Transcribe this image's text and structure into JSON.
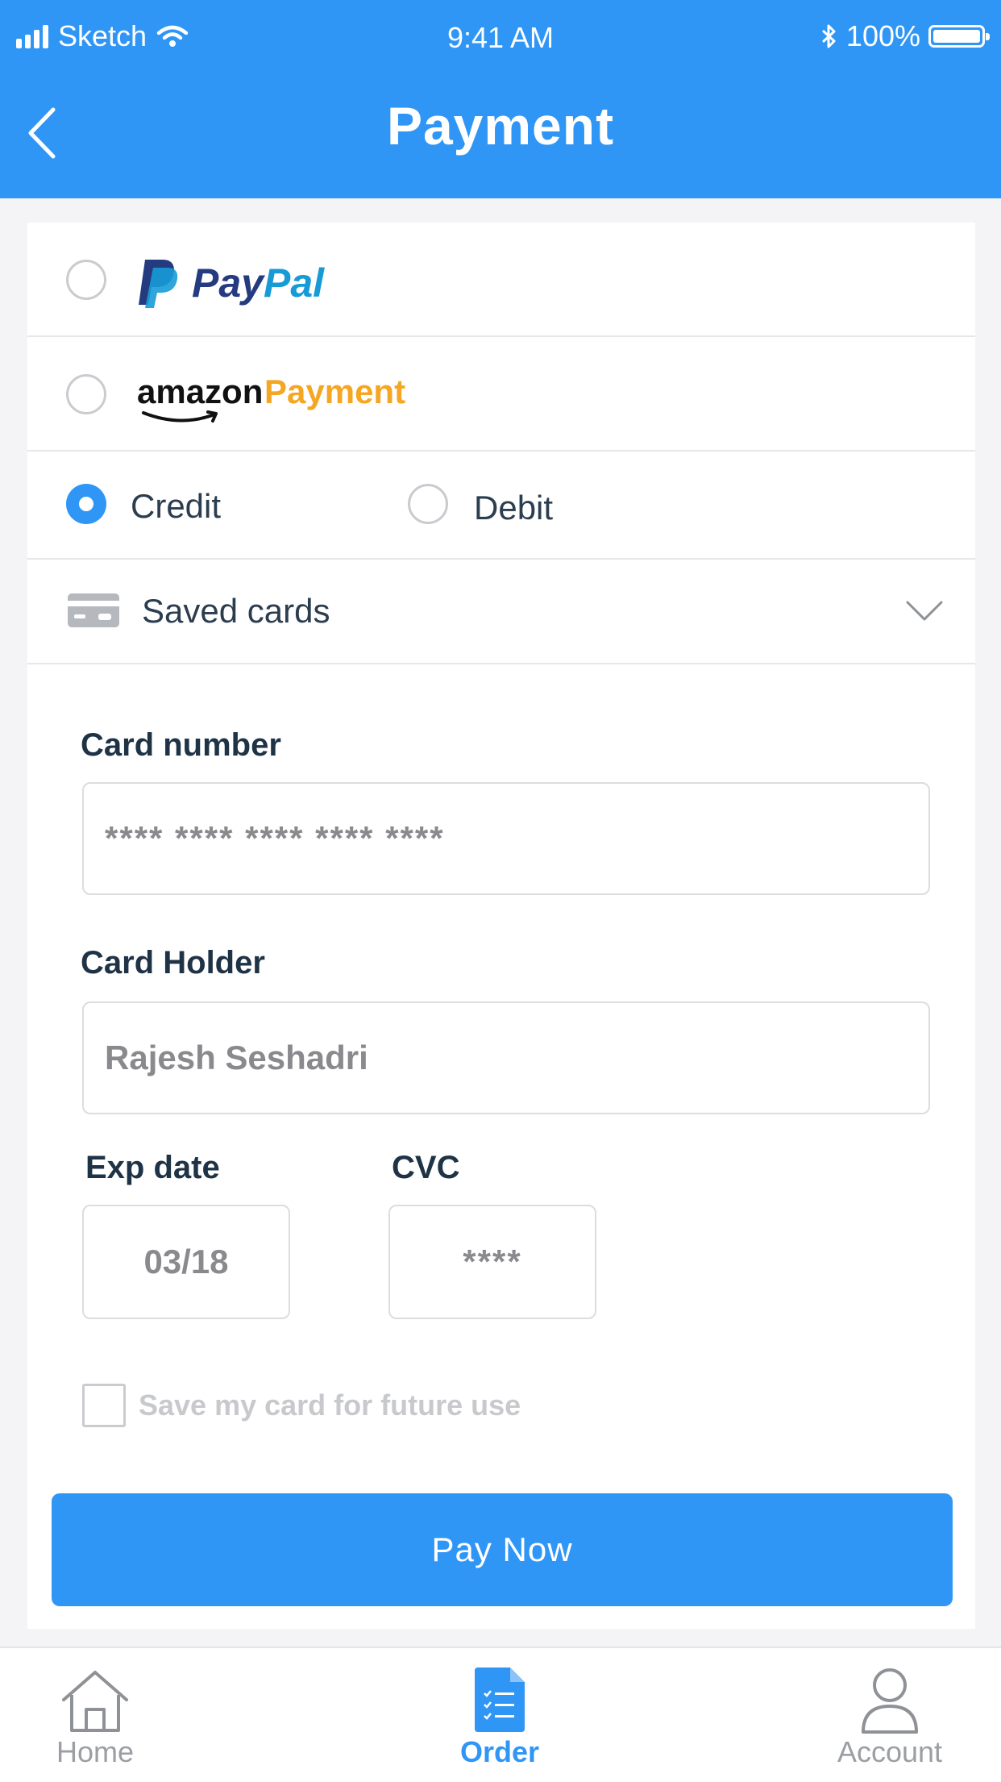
{
  "status_bar": {
    "carrier": "Sketch",
    "time": "9:41 AM",
    "battery": "100%"
  },
  "header": {
    "title": "Payment"
  },
  "options": {
    "paypal": {
      "pay": "Pay",
      "pal": "Pal"
    },
    "amazon": {
      "brand": "amazon",
      "suffix": "Payment"
    },
    "credit_label": "Credit",
    "debit_label": "Debit",
    "saved_cards_label": "Saved cards"
  },
  "form": {
    "card_number_label": "Card number",
    "card_number_value": "**** **** **** **** ****",
    "card_holder_label": "Card Holder",
    "card_holder_value": "Rajesh Seshadri",
    "exp_label": "Exp date",
    "exp_value": "03/18",
    "cvc_label": "CVC",
    "cvc_value": "****",
    "save_card_label": "Save my card for future use"
  },
  "pay_button": "Pay Now",
  "tabs": [
    {
      "label": "Home",
      "icon": "home-icon"
    },
    {
      "label": "Order",
      "icon": "order-icon",
      "active": true
    },
    {
      "label": "Account",
      "icon": "account-icon"
    }
  ],
  "colors": {
    "accent": "#3096f6",
    "amazon_orange": "#f5a623",
    "paypal_dark": "#253b80",
    "paypal_light": "#179bd7"
  }
}
